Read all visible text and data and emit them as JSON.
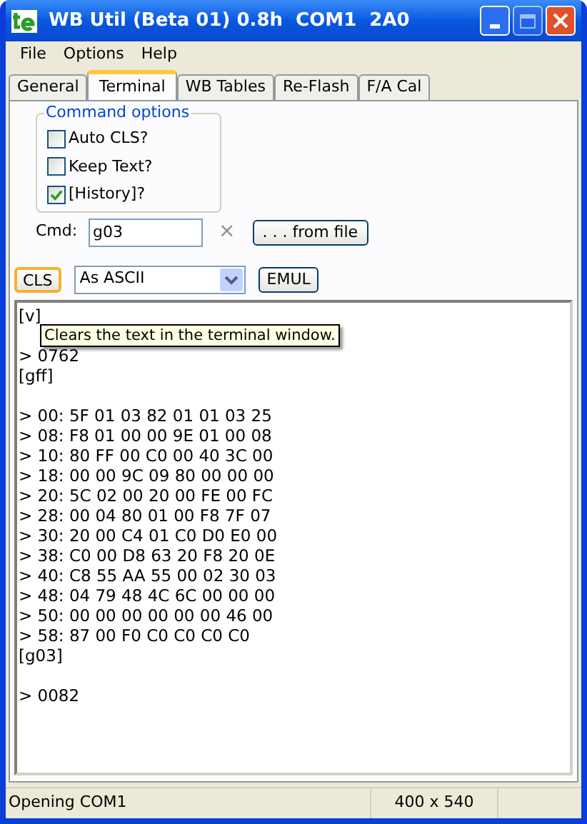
{
  "window": {
    "title": "WB Util (Beta 01) 0.8h  COM1  2A0"
  },
  "menu": [
    "File",
    "Options",
    "Help"
  ],
  "tabs": [
    {
      "label": "General",
      "selected": false
    },
    {
      "label": "Terminal",
      "selected": true
    },
    {
      "label": "WB Tables",
      "selected": false
    },
    {
      "label": "Re-Flash",
      "selected": false
    },
    {
      "label": "F/A Cal",
      "selected": false
    }
  ],
  "command_options": {
    "title": "Command options",
    "items": [
      {
        "label": "Auto CLS?",
        "checked": false
      },
      {
        "label": "Keep Text?",
        "checked": false
      },
      {
        "label": "[History]?",
        "checked": true
      }
    ]
  },
  "cmd": {
    "label": "Cmd:",
    "value": "g03",
    "clear": "×",
    "file_button": ". . . from file"
  },
  "toolbar": {
    "cls_button": "CLS",
    "mode": "As ASCII",
    "emul_button": "EMUL"
  },
  "terminal": {
    "blocks": [
      [
        "[v]"
      ],
      [
        "> 0762",
        "[gff]"
      ],
      [
        "> 00: 5F 01 03 82 01 01 03 25",
        "> 08: F8 01 00 00 9E 01 00 08",
        "> 10: 80 FF 00 C0 00 40 3C 00",
        "> 18: 00 00 9C 09 80 00 00 00",
        "> 20: 5C 02 00 20 00 FE 00 FC",
        "> 28: 00 04 80 01 00 F8 7F 07",
        "> 30: 20 00 C4 01 C0 D0 E0 00",
        "> 38: C0 00 D8 63 20 F8 20 0E",
        "> 40: C8 55 AA 55 00 02 30 03",
        "> 48: 04 79 48 4C 6C 00 00 00",
        "> 50: 00 00 00 00 00 00 46 00",
        "> 58: 87 00 F0 C0 C0 C0 C0",
        "[g03]"
      ],
      [
        "> 0082"
      ]
    ],
    "tooltip": "Clears the text in the terminal window."
  },
  "status_bar": [
    "Opening COM1",
    "400 x 540"
  ]
}
